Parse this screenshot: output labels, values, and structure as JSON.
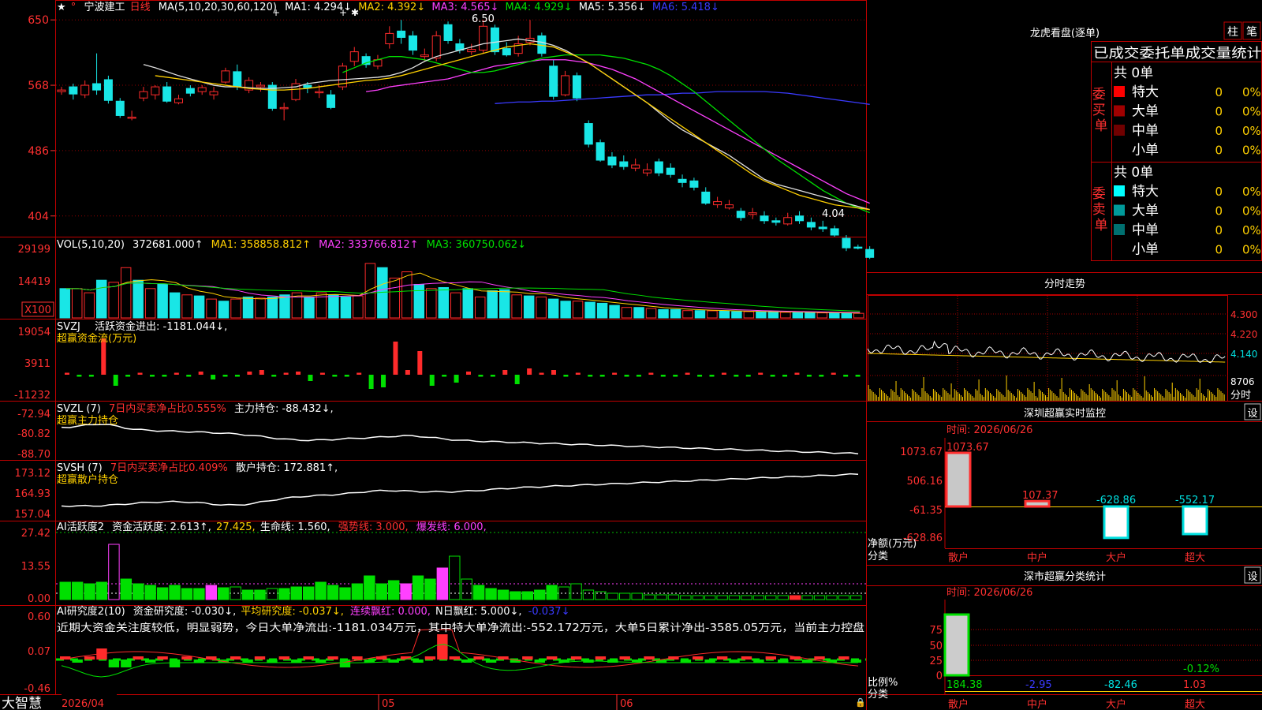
{
  "app": {
    "brand": "大智慧"
  },
  "colors": {
    "up": "#ff2b2b",
    "down": "#19e6e6",
    "grid": "#c00000",
    "axis": "#ff3030",
    "white": "#ffffff",
    "yellow": "#ffd000",
    "magenta": "#ff40ff",
    "green": "#00e000",
    "blue": "#3a3aff"
  },
  "header": {
    "star": "★",
    "stock_name": "宁波建工",
    "period": "日线",
    "ma_label": "MA(5,10,20,30,60,120)",
    "ma1": "MA1: 4.294↓",
    "ma2": "MA2: 4.392↓",
    "ma3": "MA3: 4.565↓",
    "ma4": "MA4: 4.929↓",
    "ma5": "MA5: 5.356↓",
    "ma6": "MA6: 5.418↓"
  },
  "price_panel": {
    "y_ticks": [
      "650",
      "568",
      "486",
      "404"
    ],
    "high_label": "6.50",
    "low_label": "4.04"
  },
  "vol_panel": {
    "title": "VOL(5,10,20)",
    "value": "372681.000↑",
    "ma1": "MA1: 358858.812↑",
    "ma2": "MA2: 333766.812↑",
    "ma3": "MA3: 360750.062↓",
    "y_ticks": [
      "29199",
      "14419"
    ],
    "unit": "X100"
  },
  "svzj_panel": {
    "title": "SVZJ",
    "label": "活跃资金进出: -1181.044↓,",
    "subtitle": "超赢资金流(万元)",
    "y_ticks": [
      "19054",
      "3911",
      "-11232"
    ]
  },
  "svzl_panel": {
    "title": "SVZL (7)",
    "label1": "7日内买卖净占比0.555%",
    "label2": "主力持仓: -88.432↓,",
    "subtitle": "超赢主力持仓",
    "y_ticks": [
      "-72.94",
      "-80.82",
      "-88.70"
    ]
  },
  "svsh_panel": {
    "title": "SVSH (7)",
    "label1": "7日内买卖净占比0.409%",
    "label2": "散户持仓: 172.881↑,",
    "subtitle": "超赢散户持仓",
    "y_ticks": [
      "173.12",
      "164.93",
      "157.04"
    ]
  },
  "ai1_panel": {
    "title": "AI活跃度2",
    "label": "资金活跃度: 2.613↑,",
    "v2": "27.425,",
    "v3": "生命线: 1.560,",
    "v4": "强势线: 3.000,",
    "v5": "爆发线: 6.000,",
    "y_ticks": [
      "27.42",
      "13.55",
      "0.00"
    ]
  },
  "ai2_panel": {
    "title": "AI研究度2(10)",
    "label": "资金研究度: -0.030↓,",
    "v2": "平均研究度: -0.037↓,",
    "v3": "连续飘红: 0.000,",
    "v4": "N日飘红: 5.000↓,",
    "v5": "-0.037↓",
    "commentary": "近期大资金关注度较低，明显弱势，今日大单净流出:-1181.034万元，其中特大单净流出:-552.172万元，大单5日累计净出-3585.05万元，当前主力控盘",
    "y_ticks": [
      "0.60",
      "0.07",
      "-0.46"
    ]
  },
  "x_axis": {
    "labels": [
      "2026/04",
      "05",
      "06"
    ]
  },
  "dragon": {
    "title": "龙虎看盘(逐单)",
    "btn_zhu": "柱",
    "btn_bi": "笔",
    "col_header": "已成交委托单成交量统计",
    "buy_label": "委买单",
    "sell_label": "委卖单",
    "buy_total": "共 0单",
    "sell_total": "共 0单",
    "buy_rows": [
      {
        "name": "特大",
        "count": "0",
        "pct": "0%",
        "color": "#ff0000"
      },
      {
        "name": "大单",
        "count": "0",
        "pct": "0%",
        "color": "#a00000"
      },
      {
        "name": "中单",
        "count": "0",
        "pct": "0%",
        "color": "#700000"
      },
      {
        "name": "小单",
        "count": "0",
        "pct": "0%",
        "color": "#000000"
      }
    ],
    "sell_rows": [
      {
        "name": "特大",
        "count": "0",
        "pct": "0%",
        "color": "#00ffff"
      },
      {
        "name": "大单",
        "count": "0",
        "pct": "0%",
        "color": "#009a9a"
      },
      {
        "name": "中单",
        "count": "0",
        "pct": "0%",
        "color": "#007070"
      },
      {
        "name": "小单",
        "count": "0",
        "pct": "0%",
        "color": "#000000"
      }
    ]
  },
  "intraday": {
    "title": "分时走势",
    "y_ticks": [
      "4.300",
      "4.220",
      "4.140"
    ],
    "vol_tick": "8706",
    "vol_label": "分时"
  },
  "sz_monitor": {
    "title": "深圳超赢实时监控",
    "btn": "设",
    "time": "时间: 2026/06/26",
    "y_ticks": [
      "1073.67",
      "506.16",
      "-61.35",
      "-628.86"
    ],
    "y_label": "净额(万元)",
    "x_label": "分类",
    "categories": [
      "散户",
      "中户",
      "大户",
      "超大"
    ],
    "values": [
      "1073.67",
      "107.37",
      "-628.86",
      "-552.17"
    ]
  },
  "sz_class": {
    "title": "深市超赢分类统计",
    "btn": "设",
    "time": "时间: 2026/06/26",
    "y_ticks": [
      "75",
      "50",
      "25",
      "0"
    ],
    "y_label": "比例%",
    "x_label": "分类",
    "categories": [
      "散户",
      "中户",
      "大户",
      "超大"
    ],
    "values": [
      "184.38",
      "-2.95",
      "-82.46",
      "1.03"
    ],
    "extra": "-0.12%"
  },
  "chart_data": [
    {
      "type": "candlestick",
      "title": "宁波建工 日线",
      "note": "y axis shows price*100 ticks: 650/568/486/404",
      "ylim": [
        380,
        670
      ],
      "candles": [
        [
          560,
          562,
          556,
          566
        ],
        [
          566,
          557,
          550,
          570
        ],
        [
          556,
          568,
          552,
          574
        ],
        [
          570,
          562,
          556,
          608
        ],
        [
          575,
          549,
          545,
          580
        ],
        [
          548,
          530,
          527,
          552
        ],
        [
          528,
          528,
          524,
          536
        ],
        [
          552,
          560,
          548,
          566
        ],
        [
          556,
          566,
          550,
          568
        ],
        [
          566,
          548,
          546,
          572
        ],
        [
          546,
          551,
          544,
          556
        ],
        [
          564,
          558,
          554,
          568
        ],
        [
          560,
          565,
          556,
          568
        ],
        [
          556,
          560,
          550,
          566
        ],
        [
          572,
          586,
          570,
          590
        ],
        [
          585,
          566,
          562,
          594
        ],
        [
          562,
          574,
          558,
          578
        ],
        [
          566,
          568,
          560,
          572
        ],
        [
          568,
          539,
          536,
          572
        ],
        [
          540,
          540,
          524,
          546
        ],
        [
          550,
          570,
          548,
          576
        ],
        [
          568,
          565,
          558,
          572
        ],
        [
          560,
          560,
          552,
          568
        ],
        [
          556,
          540,
          538,
          562
        ],
        [
          566,
          592,
          562,
          596
        ],
        [
          598,
          610,
          592,
          616
        ],
        [
          604,
          594,
          590,
          608
        ],
        [
          592,
          600,
          588,
          606
        ],
        [
          620,
          633,
          614,
          642
        ],
        [
          636,
          628,
          620,
          650
        ],
        [
          630,
          612,
          606,
          636
        ],
        [
          604,
          606,
          598,
          614
        ],
        [
          602,
          630,
          598,
          636
        ],
        [
          644,
          624,
          620,
          648
        ],
        [
          620,
          612,
          608,
          626
        ],
        [
          610,
          613,
          606,
          620
        ],
        [
          612,
          642,
          608,
          650
        ],
        [
          640,
          610,
          606,
          644
        ],
        [
          614,
          606,
          604,
          622
        ],
        [
          608,
          620,
          604,
          630
        ],
        [
          622,
          627,
          618,
          650
        ],
        [
          630,
          608,
          604,
          634
        ],
        [
          592,
          554,
          550,
          600
        ],
        [
          556,
          580,
          554,
          586
        ],
        [
          580,
          552,
          548,
          584
        ],
        [
          520,
          494,
          490,
          524
        ],
        [
          496,
          474,
          472,
          500
        ],
        [
          478,
          468,
          464,
          484
        ],
        [
          472,
          466,
          462,
          480
        ],
        [
          464,
          468,
          460,
          476
        ],
        [
          458,
          462,
          454,
          470
        ],
        [
          472,
          458,
          454,
          476
        ],
        [
          464,
          456,
          452,
          470
        ],
        [
          450,
          446,
          440,
          456
        ],
        [
          448,
          440,
          436,
          452
        ],
        [
          434,
          420,
          418,
          440
        ],
        [
          418,
          422,
          414,
          428
        ],
        [
          414,
          418,
          412,
          424
        ],
        [
          410,
          402,
          398,
          414
        ],
        [
          406,
          408,
          400,
          414
        ],
        [
          404,
          398,
          394,
          410
        ],
        [
          398,
          396,
          392,
          402
        ],
        [
          394,
          402,
          392,
          408
        ],
        [
          404,
          398,
          394,
          410
        ],
        [
          396,
          390,
          386,
          402
        ],
        [
          390,
          388,
          384,
          398
        ],
        [
          388,
          380,
          378,
          392
        ],
        [
          376,
          364,
          360,
          380
        ],
        [
          365,
          364,
          362,
          368
        ],
        [
          362,
          352,
          350,
          366
        ]
      ],
      "ma_white": [
        594,
        590,
        585,
        580,
        576,
        572,
        568,
        566,
        566,
        565,
        564,
        564,
        565,
        566,
        570,
        572,
        574,
        575,
        576,
        577,
        578,
        580,
        584,
        590,
        598,
        604,
        608,
        612,
        616,
        620,
        622,
        624,
        626,
        624,
        622,
        618,
        612,
        604,
        596,
        586,
        576,
        566,
        556,
        546,
        534,
        522,
        512,
        504,
        496,
        488,
        480,
        470,
        460,
        450,
        444,
        440,
        436,
        432,
        428,
        424,
        420,
        416,
        412
      ],
      "ma_yellow": [
        580,
        578,
        576,
        574,
        572,
        570,
        568,
        566,
        564,
        563,
        562,
        562,
        563,
        564,
        566,
        568,
        570,
        572,
        574,
        575,
        577,
        580,
        584,
        588,
        592,
        596,
        600,
        604,
        608,
        612,
        616,
        618,
        620,
        618,
        616,
        610,
        604,
        596,
        586,
        576,
        566,
        556,
        546,
        536,
        526,
        516,
        506,
        496,
        486,
        476,
        466,
        456,
        448,
        442,
        436,
        430,
        426,
        422,
        418,
        416,
        414,
        412
      ],
      "ma_green": [
        584,
        590,
        596,
        600,
        604,
        604,
        602,
        600,
        596,
        592,
        588,
        584,
        584,
        586,
        590,
        594,
        598,
        602,
        604,
        606,
        606,
        606,
        606,
        604,
        602,
        598,
        594,
        588,
        580,
        570,
        560,
        548,
        536,
        524,
        512,
        500,
        488,
        476,
        466,
        456,
        446,
        436,
        428,
        420,
        414,
        408
      ],
      "ma_magenta": [
        560,
        562,
        566,
        568,
        570,
        572,
        574,
        576,
        580,
        584,
        588,
        592,
        594,
        596,
        598,
        600,
        600,
        600,
        598,
        596,
        592,
        588,
        582,
        576,
        568,
        560,
        552,
        544,
        536,
        528,
        520,
        512,
        504,
        496,
        488,
        480,
        472,
        464,
        456,
        448,
        440,
        432,
        426,
        420
      ],
      "ma_blue": [
        545,
        546,
        547,
        547,
        548,
        548,
        549,
        550,
        551,
        552,
        553,
        554,
        555,
        556,
        556,
        557,
        558,
        558,
        559,
        560,
        560,
        560,
        560,
        560,
        559,
        558,
        556,
        554,
        552,
        550,
        548,
        546,
        544
      ]
    },
    {
      "type": "bar",
      "title": "VOL(5,10,20)",
      "ylim": [
        0,
        32000
      ],
      "values": [
        14000,
        14000,
        12000,
        18000,
        17000,
        24000,
        18000,
        14000,
        16000,
        12000,
        11000,
        10500,
        9000,
        8000,
        9000,
        10000,
        9500,
        10000,
        11000,
        12000,
        10000,
        12000,
        11000,
        10000,
        10500,
        26000,
        24000,
        19000,
        22000,
        16000,
        14000,
        14500,
        12000,
        14000,
        10000,
        13000,
        13500,
        11000,
        10500,
        10000,
        9000,
        8000,
        8000,
        7500,
        7000,
        6000,
        5000,
        5000,
        4500,
        4000,
        4000,
        3500,
        3500,
        3400,
        3200,
        3000,
        3000,
        2900,
        2800,
        2700,
        2600,
        2500,
        2400,
        2300,
        2300,
        2200
      ],
      "up": [
        false,
        true,
        true,
        false,
        true,
        true,
        false,
        true,
        false,
        false,
        true,
        false,
        true,
        false,
        true,
        false,
        true,
        false,
        false,
        true,
        false,
        true,
        false,
        false,
        true,
        true,
        false,
        true,
        true,
        false,
        true,
        false,
        true,
        false,
        true,
        false,
        false,
        true,
        false,
        true,
        false,
        false,
        true,
        false,
        false,
        false,
        true,
        false,
        true,
        false,
        false,
        true,
        false,
        true,
        false,
        false,
        true,
        false,
        false,
        true,
        false,
        false,
        true,
        false,
        false,
        true
      ]
    }
  ]
}
